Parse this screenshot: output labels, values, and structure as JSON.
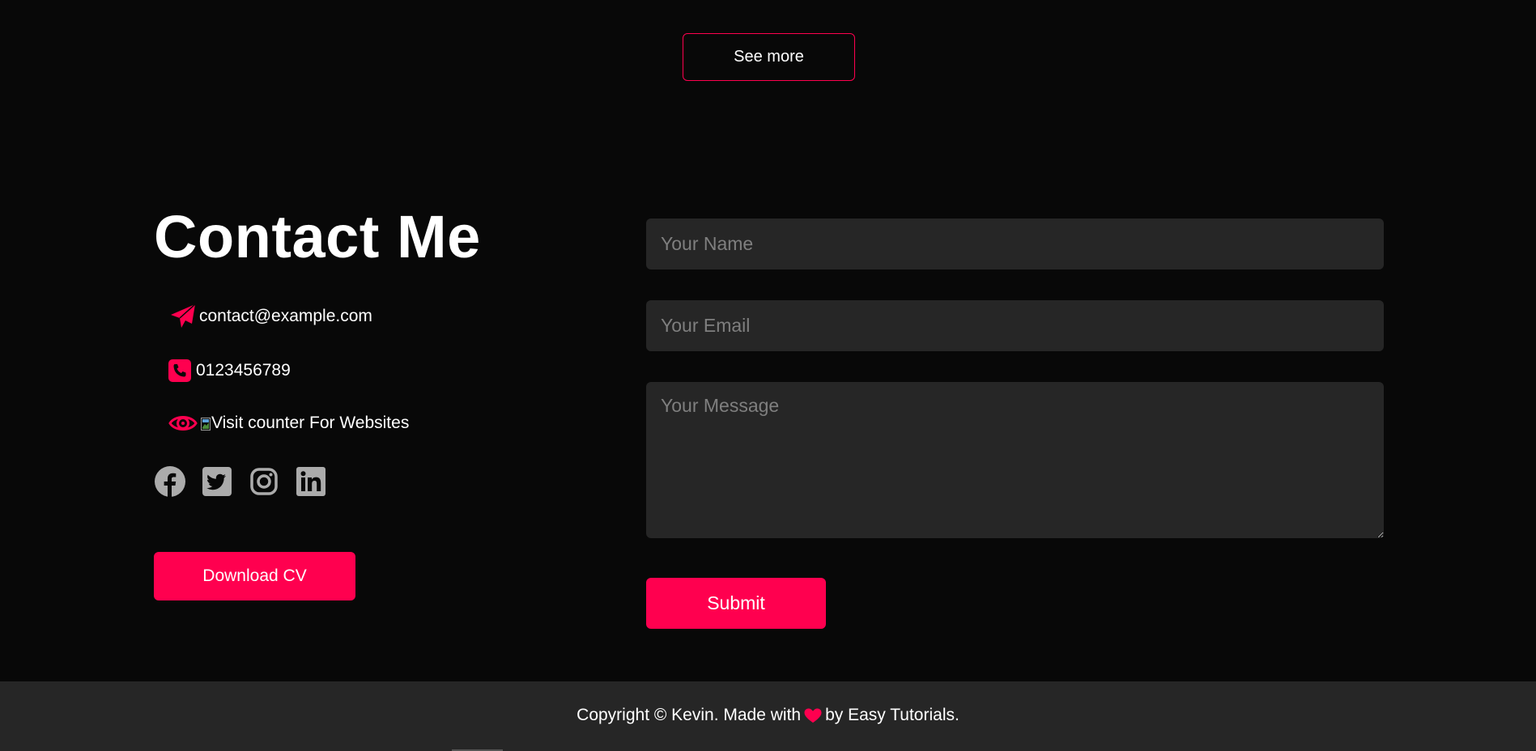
{
  "portfolio": {
    "see_more_label": "See more"
  },
  "contact": {
    "title": "Contact Me",
    "email": "contact@example.com",
    "phone": "0123456789",
    "counter_alt": "Visit counter For Websites",
    "download_cv_label": "Download CV",
    "icons": {
      "email": "paper-plane-icon",
      "phone": "phone-square-icon",
      "counter": "eye-icon"
    },
    "social": [
      {
        "name": "facebook",
        "icon": "facebook-icon"
      },
      {
        "name": "twitter",
        "icon": "twitter-icon"
      },
      {
        "name": "instagram",
        "icon": "instagram-icon"
      },
      {
        "name": "linkedin",
        "icon": "linkedin-icon"
      }
    ]
  },
  "form": {
    "name_placeholder": "Your Name",
    "email_placeholder": "Your Email",
    "message_placeholder": "Your Message",
    "submit_label": "Submit"
  },
  "footer": {
    "copyright_prefix": "Copyright © Kevin. Made with",
    "copyright_suffix": "by Easy Tutorials."
  },
  "colors": {
    "accent": "#ff004f",
    "background": "#080808",
    "panel": "#262626",
    "social_icon": "#ababab"
  }
}
